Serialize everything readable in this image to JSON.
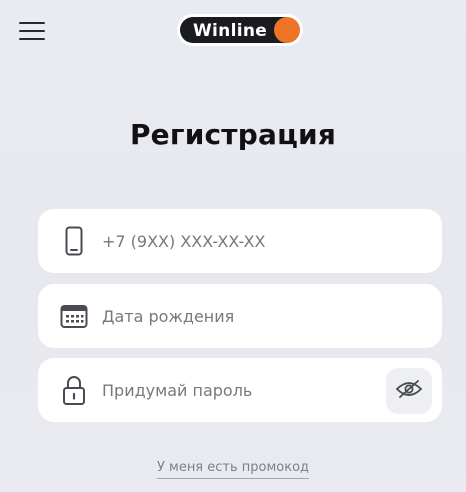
{
  "header": {
    "menu_icon": "hamburger-menu-icon",
    "logo_text": "Winline",
    "logo_dot_color": "#ee7427"
  },
  "page": {
    "title": "Регистрация"
  },
  "form": {
    "phone": {
      "icon": "smartphone-icon",
      "placeholder": "+7 (9XX) XXX-XX-XX",
      "value": ""
    },
    "birthdate": {
      "icon": "calendar-icon",
      "placeholder": "Дата рождения",
      "value": ""
    },
    "password": {
      "icon": "lock-icon",
      "placeholder": "Придумай пароль",
      "value": "",
      "toggle_icon": "eye-slash-icon"
    }
  },
  "promo": {
    "link_text": "У меня есть промокод"
  },
  "colors": {
    "accent": "#ee7427",
    "background": "#e8eaf0",
    "field_bg": "#ffffff",
    "text_primary": "#111114",
    "text_placeholder": "#77787e"
  }
}
